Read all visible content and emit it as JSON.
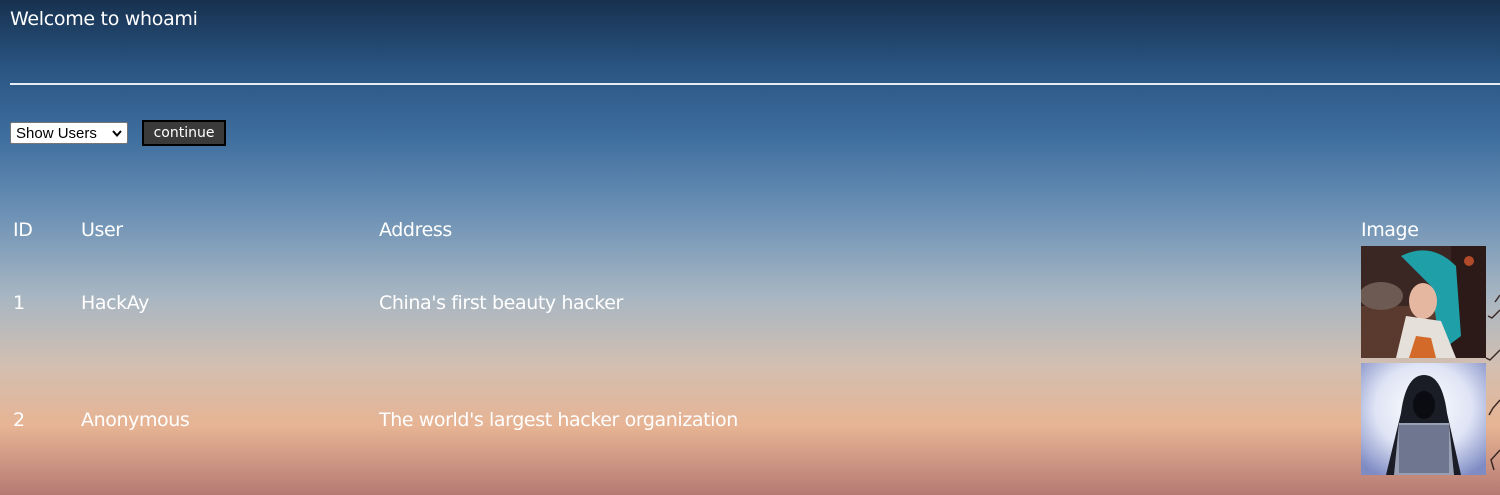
{
  "page": {
    "title": "Welcome to whoami"
  },
  "controls": {
    "select_value": "Show Users",
    "continue_label": "continue"
  },
  "table": {
    "headers": [
      "ID",
      "User",
      "Address",
      "Image"
    ],
    "rows": [
      {
        "id": "1",
        "user": "HackAy",
        "address": "China's first beauty hacker",
        "image": "user-photo-hackay"
      },
      {
        "id": "2",
        "user": "Anonymous",
        "address": "The world's largest hacker organization",
        "image": "user-photo-anonymous"
      }
    ]
  },
  "colors": {
    "text": "#ffffff",
    "button_bg": "#3a3a3a",
    "divider": "#e6ecf2"
  }
}
